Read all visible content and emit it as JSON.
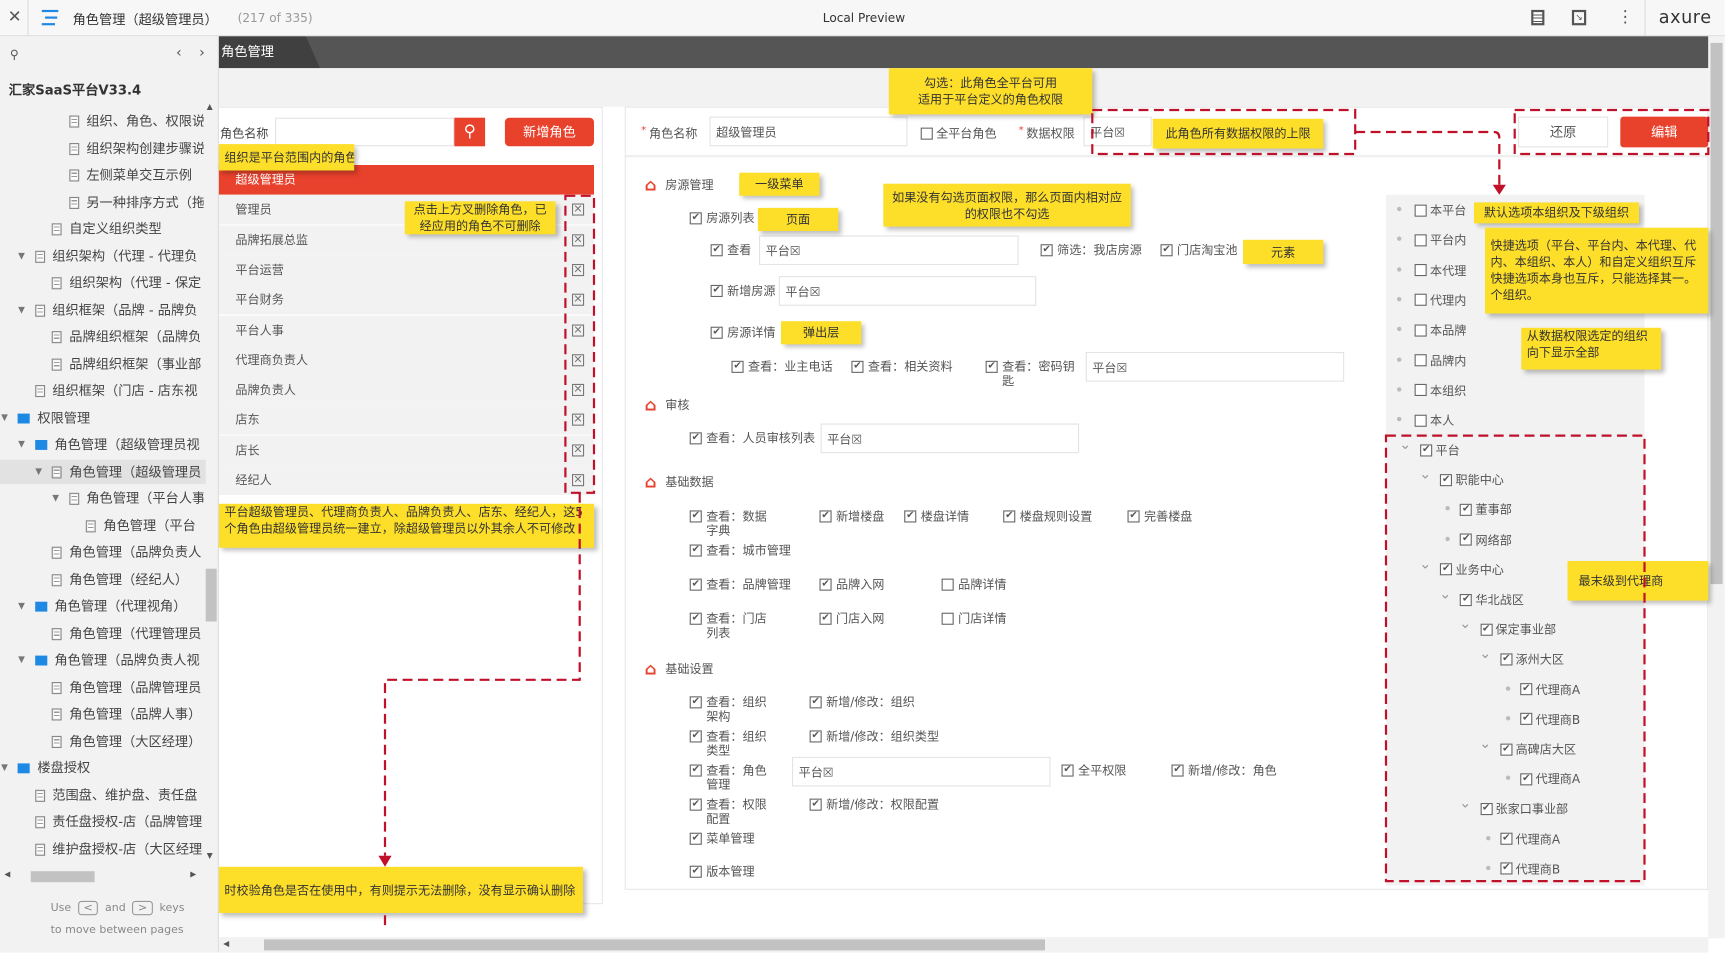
{
  "topbar": {
    "page_title": "角色管理（超级管理员）",
    "page_count": "(217 of 335)",
    "preview_label": "Local Preview",
    "brand": "axure"
  },
  "sidebar": {
    "project_title": "汇家SaaS平台V33.4",
    "tree": [
      {
        "label": "组织、角色、权限说",
        "type": "doc",
        "level": 3
      },
      {
        "label": "组织架构创建步骤说",
        "type": "doc",
        "level": 3
      },
      {
        "label": "左侧菜单交互示例",
        "type": "doc",
        "level": 3
      },
      {
        "label": "另一种排序方式（拖",
        "type": "doc",
        "level": 3
      },
      {
        "label": "自定义组织类型",
        "type": "doc",
        "level": 2
      },
      {
        "label": "组织架构（代理 - 代理负",
        "type": "doc",
        "level": 1,
        "expanded": true
      },
      {
        "label": "组织架构（代理 - 保定",
        "type": "doc",
        "level": 2
      },
      {
        "label": "组织框架（品牌 - 品牌负",
        "type": "doc",
        "level": 1,
        "expanded": true
      },
      {
        "label": "品牌组织框架（品牌负",
        "type": "doc",
        "level": 2
      },
      {
        "label": "品牌组织框架（事业部",
        "type": "doc",
        "level": 2
      },
      {
        "label": "组织框架（门店 - 店东视",
        "type": "doc",
        "level": 1
      },
      {
        "label": "权限管理",
        "type": "folder",
        "level": 0,
        "expanded": true
      },
      {
        "label": "角色管理（超级管理员视",
        "type": "folder",
        "level": 1,
        "expanded": true
      },
      {
        "label": "角色管理（超级管理员",
        "type": "doc",
        "level": 2,
        "expanded": true,
        "selected": true
      },
      {
        "label": "角色管理（平台人事",
        "type": "doc",
        "level": 3,
        "expanded": true
      },
      {
        "label": "角色管理（平台",
        "type": "doc",
        "level": 4
      },
      {
        "label": "角色管理（品牌负责人",
        "type": "doc",
        "level": 2
      },
      {
        "label": "角色管理（经纪人）",
        "type": "doc",
        "level": 2
      },
      {
        "label": "角色管理（代理视角）",
        "type": "folder",
        "level": 1,
        "expanded": true
      },
      {
        "label": "角色管理（代理管理员",
        "type": "doc",
        "level": 2
      },
      {
        "label": "角色管理（品牌负责人视",
        "type": "folder",
        "level": 1,
        "expanded": true
      },
      {
        "label": "角色管理（品牌管理员",
        "type": "doc",
        "level": 2
      },
      {
        "label": "角色管理（品牌人事）",
        "type": "doc",
        "level": 2
      },
      {
        "label": "角色管理（大区经理）",
        "type": "doc",
        "level": 2
      },
      {
        "label": "楼盘授权",
        "type": "folder",
        "level": 0,
        "expanded": true
      },
      {
        "label": "范围盘、维护盘、责任盘",
        "type": "doc",
        "level": 1
      },
      {
        "label": "责任盘授权-店（品牌管理",
        "type": "doc",
        "level": 1
      },
      {
        "label": "维护盘授权-店（大区经理",
        "type": "doc",
        "level": 1
      }
    ],
    "hint_use": "Use",
    "hint_and": "and",
    "hint_keys": "keys",
    "hint_line2": "to move between pages",
    "key_prev": "<",
    "key_next": ">"
  },
  "tab": {
    "label": "角色管理"
  },
  "roles": {
    "search_label": "角色名称",
    "search_value": "",
    "add_button": "新增角色",
    "items": [
      "超级管理员",
      "管理员",
      "品牌拓展总监",
      "平台运营",
      "平台财务",
      "平台人事",
      "代理商负责人",
      "品牌负责人",
      "店东",
      "店长",
      "经纪人"
    ],
    "selected": 0,
    "delete_icon": "☒"
  },
  "form": {
    "name_label": "角色名称",
    "name_value": "超级管理员",
    "all_platform_label": "全平台角色",
    "all_platform_checked": false,
    "data_perm_label": "数据权限",
    "data_perm_value": "平台☒",
    "reset_button": "还原",
    "edit_button": "编辑"
  },
  "permissions": {
    "sections": [
      {
        "title": "房源管理",
        "items": [
          {
            "label": "房源列表",
            "checked": true
          },
          {
            "label": "查看",
            "checked": true,
            "value": "平台☒"
          },
          {
            "label": "筛选：我店房源",
            "checked": true
          },
          {
            "label": "门店淘宝池",
            "checked": true
          },
          {
            "label": "新增房源",
            "checked": true,
            "value": "平台☒"
          },
          {
            "label": "房源详情",
            "checked": true
          },
          {
            "label": "查看：业主电话",
            "checked": true
          },
          {
            "label": "查看：相关资料",
            "checked": true
          },
          {
            "label": "查看：密码钥匙",
            "checked": true,
            "value": "平台☒"
          }
        ]
      },
      {
        "title": "审核",
        "items": [
          {
            "label": "查看：人员审核列表",
            "checked": true,
            "value": "平台☒"
          }
        ]
      },
      {
        "title": "基础数据",
        "items": [
          {
            "label": "查看：数据字典",
            "checked": true
          },
          {
            "label": "新增楼盘",
            "checked": true
          },
          {
            "label": "楼盘详情",
            "checked": true
          },
          {
            "label": "楼盘规则设置",
            "checked": true
          },
          {
            "label": "完善楼盘",
            "checked": true
          },
          {
            "label": "查看：城市管理",
            "checked": true
          },
          {
            "label": "查看：品牌管理",
            "checked": true
          },
          {
            "label": "品牌入网",
            "checked": true
          },
          {
            "label": "品牌详情",
            "checked": false
          },
          {
            "label": "查看：门店列表",
            "checked": true
          },
          {
            "label": "门店入网",
            "checked": true
          },
          {
            "label": "门店详情",
            "checked": false
          }
        ]
      },
      {
        "title": "基础设置",
        "items": [
          {
            "label": "查看：组织架构",
            "checked": true
          },
          {
            "label": "新增/修改：组织",
            "checked": true
          },
          {
            "label": "查看：组织类型",
            "checked": true
          },
          {
            "label": "新增/修改：组织类型",
            "checked": true
          },
          {
            "label": "查看：角色管理",
            "checked": true,
            "value": "平台☒"
          },
          {
            "label": "全平权限",
            "checked": true
          },
          {
            "label": "新增/修改：角色",
            "checked": true
          },
          {
            "label": "查看：权限配置",
            "checked": true
          },
          {
            "label": "新增/修改：权限配置",
            "checked": true
          },
          {
            "label": "菜单管理",
            "checked": true
          },
          {
            "label": "版本管理",
            "checked": true
          }
        ]
      }
    ]
  },
  "org": {
    "quick_options": [
      "本平台",
      "平台内",
      "本代理",
      "代理内",
      "本品牌",
      "品牌内",
      "本组织",
      "本人"
    ],
    "tree": [
      {
        "label": "平台",
        "level": 0,
        "expandable": true,
        "checked": true
      },
      {
        "label": "职能中心",
        "level": 1,
        "expandable": true,
        "checked": true
      },
      {
        "label": "董事部",
        "level": 2,
        "expandable": false,
        "checked": true
      },
      {
        "label": "网络部",
        "level": 2,
        "expandable": false,
        "checked": true
      },
      {
        "label": "业务中心",
        "level": 1,
        "expandable": true,
        "checked": true
      },
      {
        "label": "华北战区",
        "level": 2,
        "expandable": true,
        "checked": true
      },
      {
        "label": "保定事业部",
        "level": 3,
        "expandable": true,
        "checked": true
      },
      {
        "label": "涿州大区",
        "level": 4,
        "expandable": true,
        "checked": true
      },
      {
        "label": "代理商A",
        "level": 5,
        "expandable": false,
        "checked": true
      },
      {
        "label": "代理商B",
        "level": 5,
        "expandable": false,
        "checked": true
      },
      {
        "label": "高碑店大区",
        "level": 4,
        "expandable": true,
        "checked": true
      },
      {
        "label": "代理商A",
        "level": 5,
        "expandable": false,
        "checked": true
      },
      {
        "label": "张家口事业部",
        "level": 3,
        "expandable": true,
        "checked": true
      },
      {
        "label": "代理商A",
        "level": 4,
        "expandable": false,
        "checked": true
      },
      {
        "label": "代理商B",
        "level": 4,
        "expandable": false,
        "checked": true
      }
    ]
  },
  "notes": {
    "platform_scope": "组织是平台范围内的角色",
    "delete_hint": [
      "点击上方叉删除角色，已",
      "经应用的角色不可删除"
    ],
    "fixed_roles": [
      "平台超级管理员、代理商负责人、品牌负责人、店东、经纪人，这5",
      "个角色由超级管理员统一建立，除超级管理员以外其余人不可修改"
    ],
    "delete_check": "时校验角色是否在使用中，有则提示无法删除，没有显示确认删除",
    "all_platform": [
      "勾选：此角色全平台可用",
      "适用于平台定义的角色权限"
    ],
    "data_limit": "此角色所有数据权限的上限",
    "level1_menu": "一级菜单",
    "page": "页面",
    "page_perm": [
      "如果没有勾选页面权限，那么页面内相对应",
      "的权限也不勾选"
    ],
    "element": "元素",
    "popup": "弹出层",
    "default_option": "默认选项本组织及下级组织",
    "quick_exclusive": [
      "快捷选项（平台、平台内、本代理、代",
      "内、本组织、本人）和自定义组织互斥",
      "快捷选项本身也互斥，只能选择其一。",
      "个组织。"
    ],
    "show_all": [
      "从数据权限选定的组织",
      "向下显示全部"
    ],
    "last_level": "最末级到代理商"
  },
  "colors": {
    "accent": "#e8412c",
    "note": "#fddf2a",
    "dashed": "#c0102a",
    "folder": "#1e88e5",
    "header": "#555555"
  }
}
